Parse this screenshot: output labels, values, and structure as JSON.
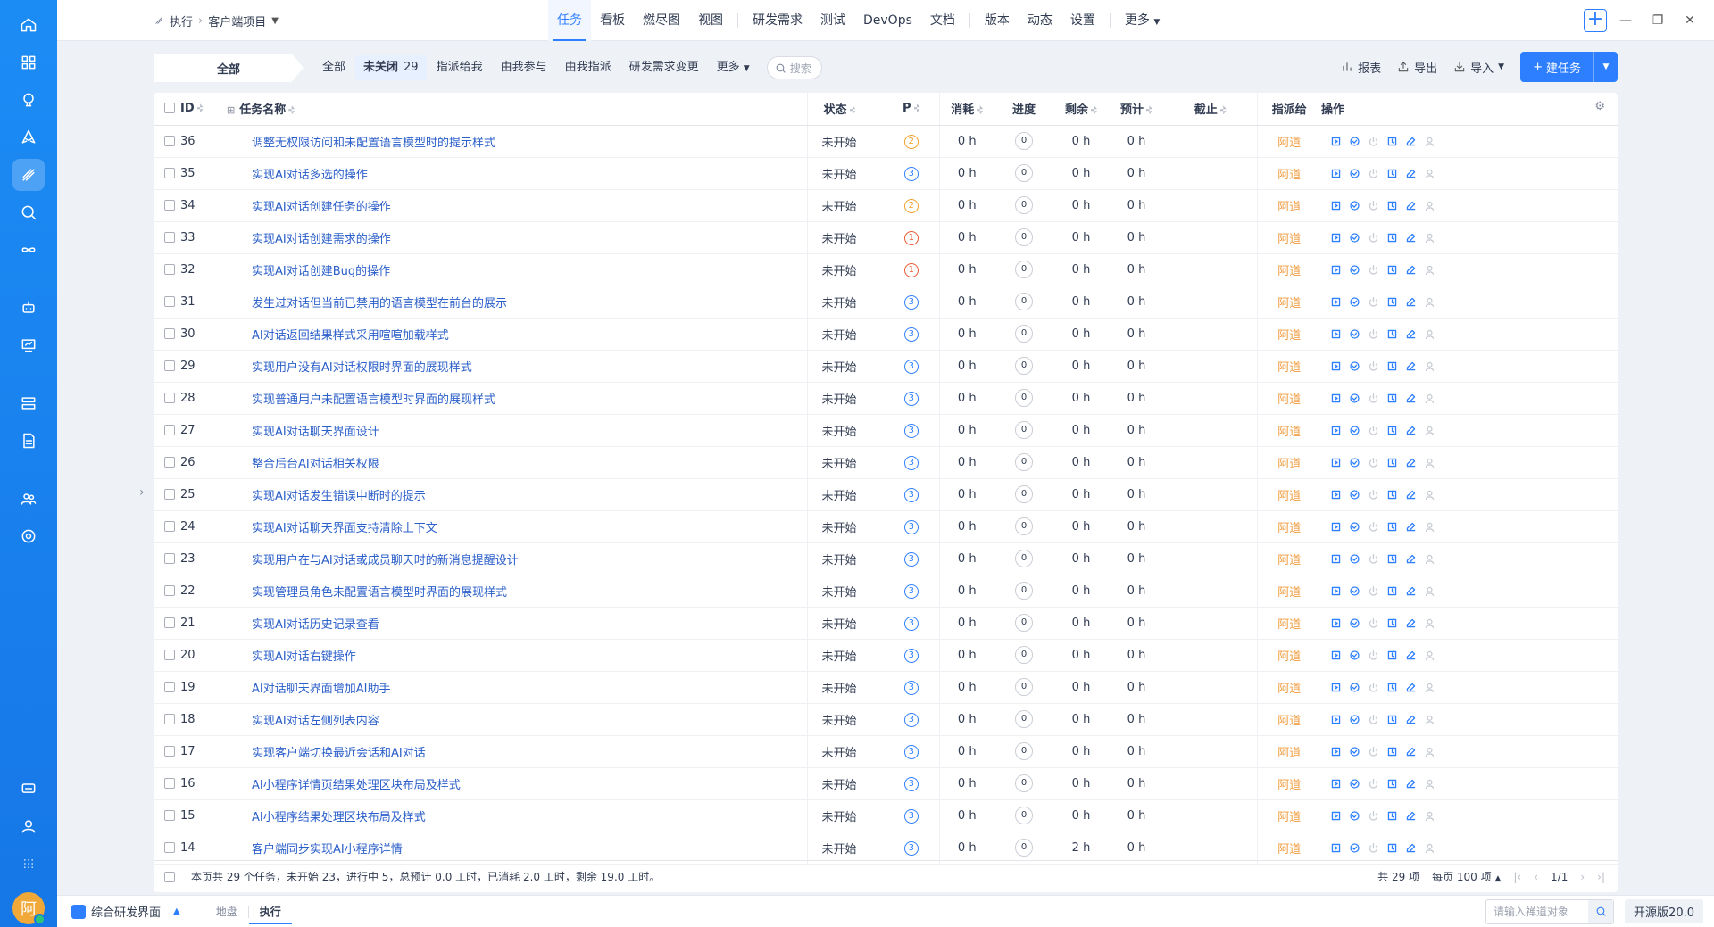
{
  "breadcrumb": {
    "module": "执行",
    "project": "客户端项目"
  },
  "nav": {
    "tabs": [
      "任务",
      "看板",
      "燃尽图",
      "视图"
    ],
    "tabs2": [
      "研发需求",
      "测试",
      "DevOps",
      "文档"
    ],
    "tabs3": [
      "版本",
      "动态",
      "设置"
    ],
    "more": "更多",
    "active": "任务"
  },
  "toolbar": {
    "all_label": "全部",
    "filters": [
      {
        "label": "全部"
      },
      {
        "label": "未关闭",
        "count": "29",
        "active": true
      },
      {
        "label": "指派给我"
      },
      {
        "label": "由我参与"
      },
      {
        "label": "由我指派"
      },
      {
        "label": "研发需求变更"
      },
      {
        "label": "更多"
      }
    ],
    "search_placeholder": "搜索",
    "report": "报表",
    "export": "导出",
    "import": "导入",
    "new_task": "建任务"
  },
  "table": {
    "columns": {
      "id": "ID",
      "name": "任务名称",
      "status": "状态",
      "pri": "P",
      "consumed": "消耗",
      "progress": "进度",
      "left": "剩余",
      "estimate": "预计",
      "deadline": "截止",
      "assigned": "指派给",
      "actions": "操作"
    },
    "rows": [
      {
        "id": "36",
        "name": "调整无权限访问和未配置语言模型时的提示样式",
        "status": "未开始",
        "pri": "2",
        "consumed": "0 h",
        "progress": "0",
        "left": "0 h",
        "estimate": "0 h",
        "assigned": "阿道"
      },
      {
        "id": "35",
        "name": "实现AI对话多选的操作",
        "status": "未开始",
        "pri": "3",
        "consumed": "0 h",
        "progress": "0",
        "left": "0 h",
        "estimate": "0 h",
        "assigned": "阿道"
      },
      {
        "id": "34",
        "name": "实现AI对话创建任务的操作",
        "status": "未开始",
        "pri": "2",
        "consumed": "0 h",
        "progress": "0",
        "left": "0 h",
        "estimate": "0 h",
        "assigned": "阿道"
      },
      {
        "id": "33",
        "name": "实现AI对话创建需求的操作",
        "status": "未开始",
        "pri": "1",
        "consumed": "0 h",
        "progress": "0",
        "left": "0 h",
        "estimate": "0 h",
        "assigned": "阿道"
      },
      {
        "id": "32",
        "name": "实现AI对话创建Bug的操作",
        "status": "未开始",
        "pri": "1",
        "consumed": "0 h",
        "progress": "0",
        "left": "0 h",
        "estimate": "0 h",
        "assigned": "阿道"
      },
      {
        "id": "31",
        "name": "发生过对话但当前已禁用的语言模型在前台的展示",
        "status": "未开始",
        "pri": "3",
        "consumed": "0 h",
        "progress": "0",
        "left": "0 h",
        "estimate": "0 h",
        "assigned": "阿道"
      },
      {
        "id": "30",
        "name": "AI对话返回结果样式采用喧喧加载样式",
        "status": "未开始",
        "pri": "3",
        "consumed": "0 h",
        "progress": "0",
        "left": "0 h",
        "estimate": "0 h",
        "assigned": "阿道"
      },
      {
        "id": "29",
        "name": "实现用户没有AI对话权限时界面的展现样式",
        "status": "未开始",
        "pri": "3",
        "consumed": "0 h",
        "progress": "0",
        "left": "0 h",
        "estimate": "0 h",
        "assigned": "阿道"
      },
      {
        "id": "28",
        "name": "实现普通用户未配置语言模型时界面的展现样式",
        "status": "未开始",
        "pri": "3",
        "consumed": "0 h",
        "progress": "0",
        "left": "0 h",
        "estimate": "0 h",
        "assigned": "阿道"
      },
      {
        "id": "27",
        "name": "实现AI对话聊天界面设计",
        "status": "未开始",
        "pri": "3",
        "consumed": "0 h",
        "progress": "0",
        "left": "0 h",
        "estimate": "0 h",
        "assigned": "阿道"
      },
      {
        "id": "26",
        "name": "整合后台AI对话相关权限",
        "status": "未开始",
        "pri": "3",
        "consumed": "0 h",
        "progress": "0",
        "left": "0 h",
        "estimate": "0 h",
        "assigned": "阿道"
      },
      {
        "id": "25",
        "name": "实现AI对话发生错误中断时的提示",
        "status": "未开始",
        "pri": "3",
        "consumed": "0 h",
        "progress": "0",
        "left": "0 h",
        "estimate": "0 h",
        "assigned": "阿道"
      },
      {
        "id": "24",
        "name": "实现AI对话聊天界面支持清除上下文",
        "status": "未开始",
        "pri": "3",
        "consumed": "0 h",
        "progress": "0",
        "left": "0 h",
        "estimate": "0 h",
        "assigned": "阿道"
      },
      {
        "id": "23",
        "name": "实现用户在与AI对话或成员聊天时的新消息提醒设计",
        "status": "未开始",
        "pri": "3",
        "consumed": "0 h",
        "progress": "0",
        "left": "0 h",
        "estimate": "0 h",
        "assigned": "阿道"
      },
      {
        "id": "22",
        "name": "实现管理员角色未配置语言模型时界面的展现样式",
        "status": "未开始",
        "pri": "3",
        "consumed": "0 h",
        "progress": "0",
        "left": "0 h",
        "estimate": "0 h",
        "assigned": "阿道"
      },
      {
        "id": "21",
        "name": "实现AI对话历史记录查看",
        "status": "未开始",
        "pri": "3",
        "consumed": "0 h",
        "progress": "0",
        "left": "0 h",
        "estimate": "0 h",
        "assigned": "阿道"
      },
      {
        "id": "20",
        "name": "实现AI对话右键操作",
        "status": "未开始",
        "pri": "3",
        "consumed": "0 h",
        "progress": "0",
        "left": "0 h",
        "estimate": "0 h",
        "assigned": "阿道"
      },
      {
        "id": "19",
        "name": "AI对话聊天界面增加AI助手",
        "status": "未开始",
        "pri": "3",
        "consumed": "0 h",
        "progress": "0",
        "left": "0 h",
        "estimate": "0 h",
        "assigned": "阿道"
      },
      {
        "id": "18",
        "name": "实现AI对话左侧列表内容",
        "status": "未开始",
        "pri": "3",
        "consumed": "0 h",
        "progress": "0",
        "left": "0 h",
        "estimate": "0 h",
        "assigned": "阿道"
      },
      {
        "id": "17",
        "name": "实现客户端切换最近会话和AI对话",
        "status": "未开始",
        "pri": "3",
        "consumed": "0 h",
        "progress": "0",
        "left": "0 h",
        "estimate": "0 h",
        "assigned": "阿道"
      },
      {
        "id": "16",
        "name": "AI小程序详情页结果处理区块布局及样式",
        "status": "未开始",
        "pri": "3",
        "consumed": "0 h",
        "progress": "0",
        "left": "0 h",
        "estimate": "0 h",
        "assigned": "阿道"
      },
      {
        "id": "15",
        "name": "AI小程序结果处理区块布局及样式",
        "status": "未开始",
        "pri": "3",
        "consumed": "0 h",
        "progress": "0",
        "left": "0 h",
        "estimate": "0 h",
        "assigned": "阿道"
      },
      {
        "id": "14",
        "name": "客户端同步实现AI小程序详情",
        "status": "未开始",
        "pri": "3",
        "consumed": "0 h",
        "progress": "0",
        "left": "2 h",
        "estimate": "0 h",
        "assigned": "阿道"
      }
    ]
  },
  "footer": {
    "summary": "本页共 29 个任务，未开始 23，进行中 5，总预计 0.0 工时，已消耗 2.0 工时，剩余 19.0 工时。",
    "total": "共 29 项",
    "per_page": "每页 100 项",
    "page": "1/1"
  },
  "bottombar": {
    "menu": "综合研发界面",
    "apps": [
      "地盘",
      "执行"
    ],
    "active_app": "执行",
    "search_placeholder": "请输入禅道对象",
    "version": "开源版20.0",
    "avatar_char": "阿"
  }
}
